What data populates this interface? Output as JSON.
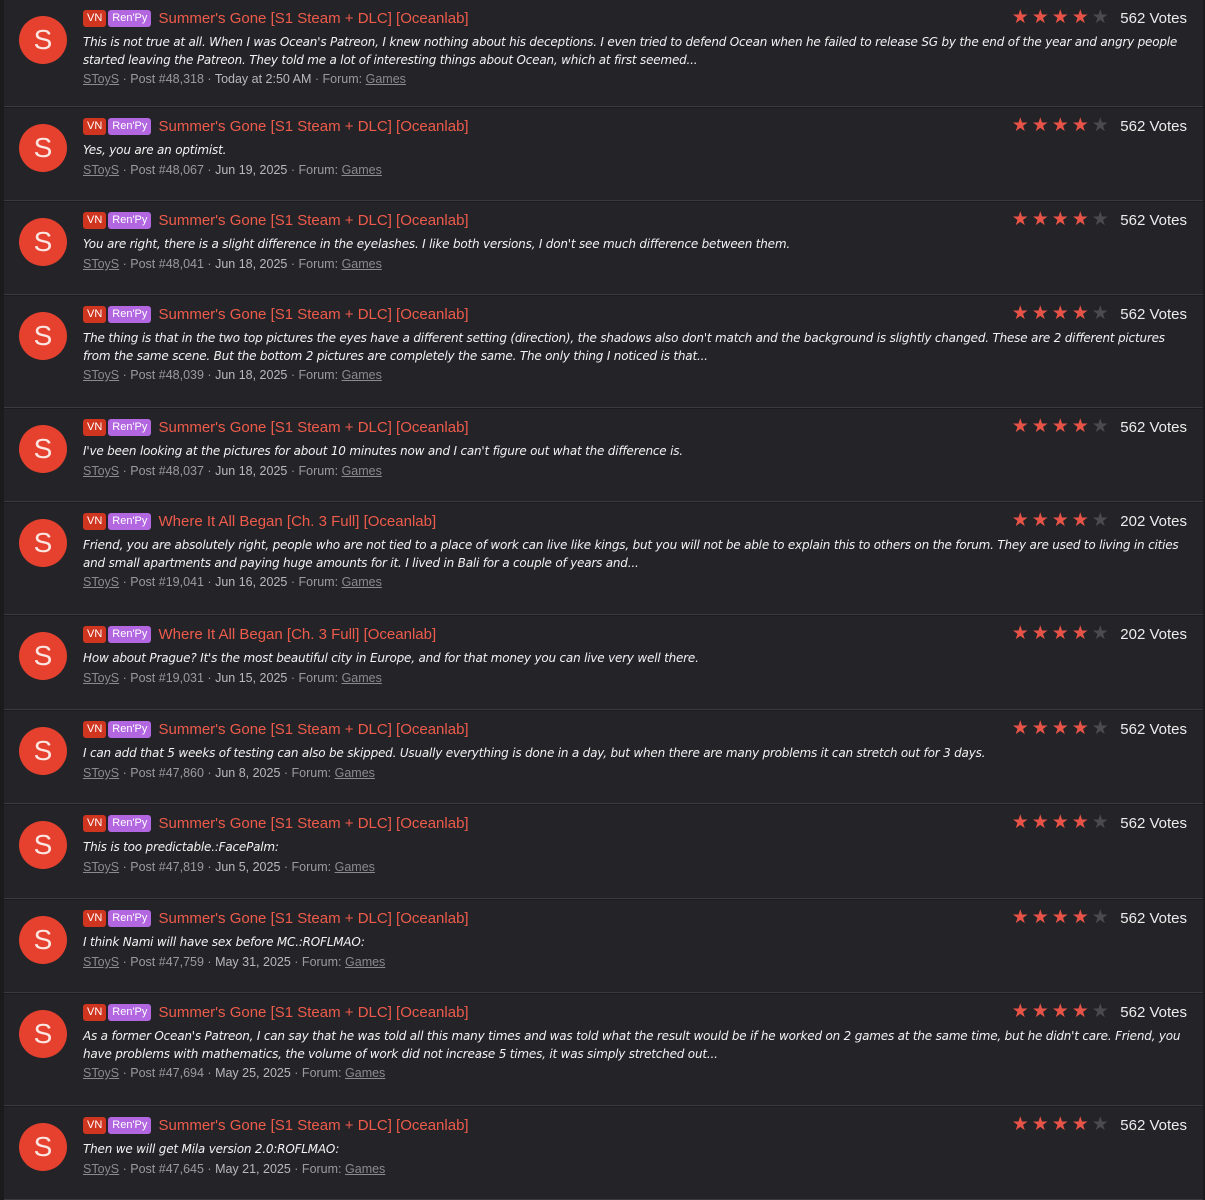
{
  "colors": {
    "accent": "#ee5b4b",
    "avatar": "#e5412e",
    "tag_vn": "#d0351f",
    "tag_renpy": "#b266e0"
  },
  "results": [
    {
      "avatar_letter": "S",
      "tag1": "VN",
      "tag2": "Ren'Py",
      "title": "Summer's Gone [S1 Steam + DLC] [Oceanlab]",
      "stars": 4,
      "votes": "562 Votes",
      "snippet": "This is not true at all. When I was Ocean's Patreon, I knew nothing about his deceptions. I even tried to defend Ocean when he failed to release SG by the end of the year and angry people started leaving the Patreon. They told me a lot of interesting things about Ocean, which at first seemed...",
      "author": "SToyS",
      "post": "· Post #48,318 ·",
      "date": "Today at 2:50 AM",
      "forum_label": "· Forum:",
      "forum": "Games"
    },
    {
      "avatar_letter": "S",
      "tag1": "VN",
      "tag2": "Ren'Py",
      "title": "Summer's Gone [S1 Steam + DLC] [Oceanlab]",
      "stars": 4,
      "votes": "562 Votes",
      "snippet": "Yes, you are an optimist.",
      "author": "SToyS",
      "post": "· Post #48,067 ·",
      "date": "Jun 19, 2025",
      "forum_label": "· Forum:",
      "forum": "Games"
    },
    {
      "avatar_letter": "S",
      "tag1": "VN",
      "tag2": "Ren'Py",
      "title": "Summer's Gone [S1 Steam + DLC] [Oceanlab]",
      "stars": 4,
      "votes": "562 Votes",
      "snippet": "You are right, there is a slight difference in the eyelashes. I like both versions, I don't see much difference between them.",
      "author": "SToyS",
      "post": "· Post #48,041 ·",
      "date": "Jun 18, 2025",
      "forum_label": "· Forum:",
      "forum": "Games"
    },
    {
      "avatar_letter": "S",
      "tag1": "VN",
      "tag2": "Ren'Py",
      "title": "Summer's Gone [S1 Steam + DLC] [Oceanlab]",
      "stars": 4,
      "votes": "562 Votes",
      "snippet": "The thing is that in the two top pictures the eyes have a different setting (direction), the shadows also don't match and the background is slightly changed. These are 2 different pictures from the same scene. But the bottom 2 pictures are completely the same. The only thing I noticed is that...",
      "author": "SToyS",
      "post": "· Post #48,039 ·",
      "date": "Jun 18, 2025",
      "forum_label": "· Forum:",
      "forum": "Games"
    },
    {
      "avatar_letter": "S",
      "tag1": "VN",
      "tag2": "Ren'Py",
      "title": "Summer's Gone [S1 Steam + DLC] [Oceanlab]",
      "stars": 4,
      "votes": "562 Votes",
      "snippet": "I've been looking at the pictures for about 10 minutes now and I can't figure out what the difference is.",
      "author": "SToyS",
      "post": "· Post #48,037 ·",
      "date": "Jun 18, 2025",
      "forum_label": "· Forum:",
      "forum": "Games"
    },
    {
      "avatar_letter": "S",
      "tag1": "VN",
      "tag2": "Ren'Py",
      "title": "Where It All Began [Ch. 3 Full] [Oceanlab]",
      "stars": 4,
      "votes": "202 Votes",
      "snippet": "Friend, you are absolutely right, people who are not tied to a place of work can live like kings, but you will not be able to explain this to others on the forum. They are used to living in cities and small apartments and paying huge amounts for it. I lived in Bali for a couple of years and...",
      "author": "SToyS",
      "post": "· Post #19,041 ·",
      "date": "Jun 16, 2025",
      "forum_label": "· Forum:",
      "forum": "Games"
    },
    {
      "avatar_letter": "S",
      "tag1": "VN",
      "tag2": "Ren'Py",
      "title": "Where It All Began [Ch. 3 Full] [Oceanlab]",
      "stars": 4,
      "votes": "202 Votes",
      "snippet": "How about Prague? It's the most beautiful city in Europe, and for that money you can live very well there.",
      "author": "SToyS",
      "post": "· Post #19,031 ·",
      "date": "Jun 15, 2025",
      "forum_label": "· Forum:",
      "forum": "Games"
    },
    {
      "avatar_letter": "S",
      "tag1": "VN",
      "tag2": "Ren'Py",
      "title": "Summer's Gone [S1 Steam + DLC] [Oceanlab]",
      "stars": 4,
      "votes": "562 Votes",
      "snippet": "I can add that 5 weeks of testing can also be skipped. Usually everything is done in a day, but when there are many problems it can stretch out for 3 days.",
      "author": "SToyS",
      "post": "· Post #47,860 ·",
      "date": "Jun 8, 2025",
      "forum_label": "· Forum:",
      "forum": "Games"
    },
    {
      "avatar_letter": "S",
      "tag1": "VN",
      "tag2": "Ren'Py",
      "title": "Summer's Gone [S1 Steam + DLC] [Oceanlab]",
      "stars": 4,
      "votes": "562 Votes",
      "snippet": "This is too predictable.:FacePalm:",
      "author": "SToyS",
      "post": "· Post #47,819 ·",
      "date": "Jun 5, 2025",
      "forum_label": "· Forum:",
      "forum": "Games"
    },
    {
      "avatar_letter": "S",
      "tag1": "VN",
      "tag2": "Ren'Py",
      "title": "Summer's Gone [S1 Steam + DLC] [Oceanlab]",
      "stars": 4,
      "votes": "562 Votes",
      "snippet": "I think Nami will have sex before MC.:ROFLMAO:",
      "author": "SToyS",
      "post": "· Post #47,759 ·",
      "date": "May 31, 2025",
      "forum_label": "· Forum:",
      "forum": "Games"
    },
    {
      "avatar_letter": "S",
      "tag1": "VN",
      "tag2": "Ren'Py",
      "title": "Summer's Gone [S1 Steam + DLC] [Oceanlab]",
      "stars": 4,
      "votes": "562 Votes",
      "snippet": "As a former Ocean's Patreon, I can say that he was told all this many times and was told what the result would be if he worked on 2 games at the same time, but he didn't care. Friend, you have problems with mathematics, the volume of work did not increase 5 times, it was simply stretched out...",
      "author": "SToyS",
      "post": "· Post #47,694 ·",
      "date": "May 25, 2025",
      "forum_label": "· Forum:",
      "forum": "Games"
    },
    {
      "avatar_letter": "S",
      "tag1": "VN",
      "tag2": "Ren'Py",
      "title": "Summer's Gone [S1 Steam + DLC] [Oceanlab]",
      "stars": 4,
      "votes": "562 Votes",
      "snippet": "Then we will get Mila version 2.0:ROFLMAO:",
      "author": "SToyS",
      "post": "· Post #47,645 ·",
      "date": "May 21, 2025",
      "forum_label": "· Forum:",
      "forum": "Games"
    }
  ]
}
